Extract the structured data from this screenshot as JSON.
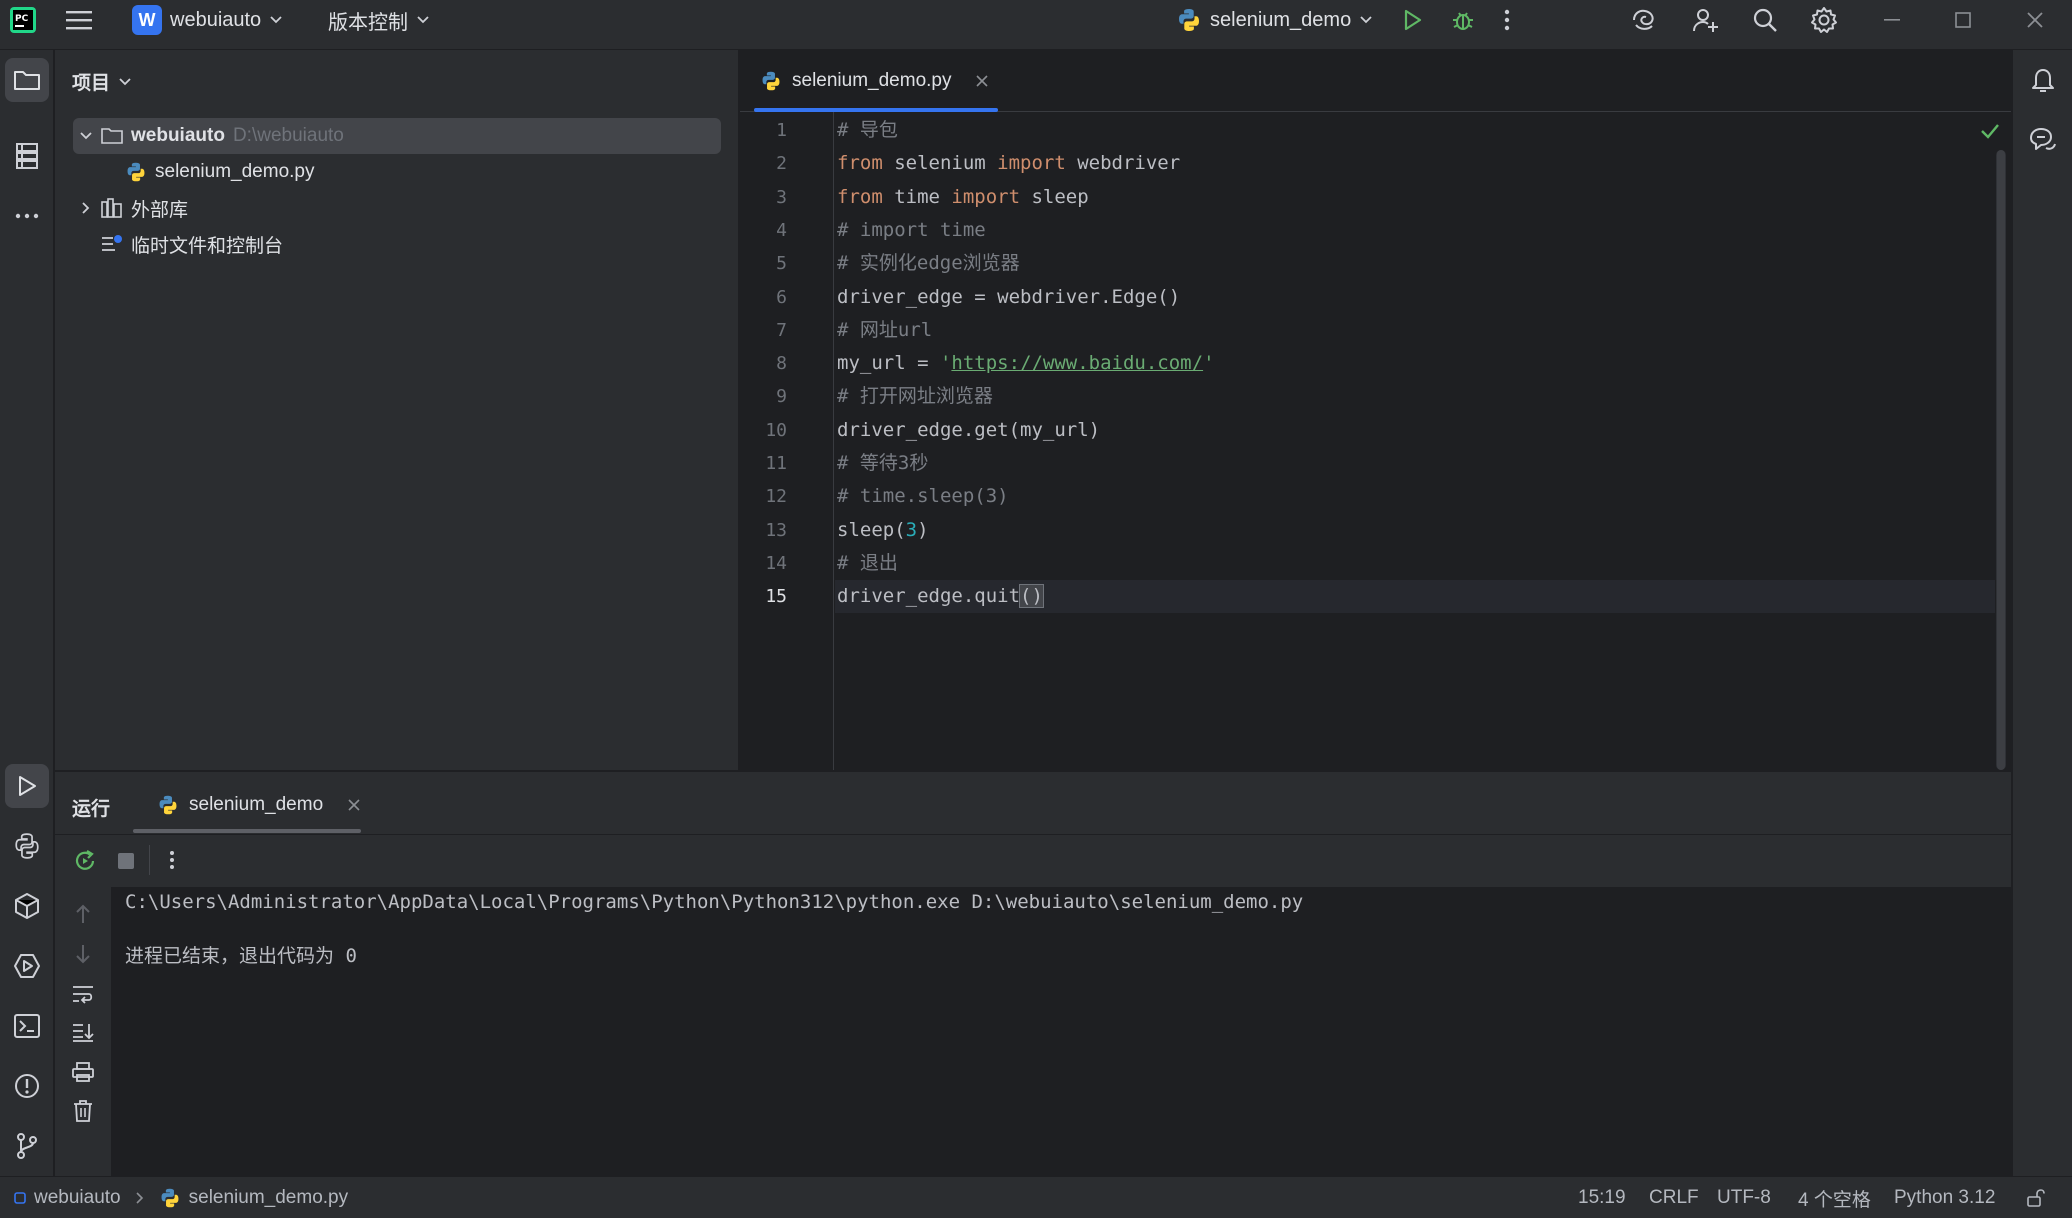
{
  "titlebar": {
    "project_badge": "W",
    "project_name": "webuiauto",
    "vcs_label": "版本控制",
    "run_config": "selenium_demo"
  },
  "project_panel": {
    "title": "项目",
    "root_name": "webuiauto",
    "root_path": "D:\\webuiauto",
    "file_name": "selenium_demo.py",
    "external_libs": "外部库",
    "scratches": "临时文件和控制台"
  },
  "editor": {
    "tab_label": "selenium_demo.py",
    "lines": [
      {
        "n": "1",
        "parts": [
          {
            "t": "# 导包",
            "c": "c-com"
          }
        ]
      },
      {
        "n": "2",
        "parts": [
          {
            "t": "from",
            "c": "c-kw"
          },
          {
            "t": " selenium ",
            "c": "c-def"
          },
          {
            "t": "import",
            "c": "c-kw"
          },
          {
            "t": " webdriver",
            "c": "c-def"
          }
        ]
      },
      {
        "n": "3",
        "parts": [
          {
            "t": "from",
            "c": "c-kw"
          },
          {
            "t": " time ",
            "c": "c-def"
          },
          {
            "t": "import",
            "c": "c-kw"
          },
          {
            "t": " sleep",
            "c": "c-def"
          }
        ]
      },
      {
        "n": "4",
        "parts": [
          {
            "t": "# import time",
            "c": "c-com"
          }
        ]
      },
      {
        "n": "5",
        "parts": [
          {
            "t": "# 实例化edge浏览器",
            "c": "c-com"
          }
        ]
      },
      {
        "n": "6",
        "parts": [
          {
            "t": "driver_edge = webdriver.Edge()",
            "c": "c-def"
          }
        ]
      },
      {
        "n": "7",
        "parts": [
          {
            "t": "# 网址url",
            "c": "c-com"
          }
        ]
      },
      {
        "n": "8",
        "parts": [
          {
            "t": "my_url = ",
            "c": "c-def"
          },
          {
            "t": "'",
            "c": "c-str"
          },
          {
            "t": "https://www.baidu.com/",
            "c": "c-str",
            "u": true
          },
          {
            "t": "'",
            "c": "c-str"
          }
        ]
      },
      {
        "n": "9",
        "parts": [
          {
            "t": "# 打开网址浏览器",
            "c": "c-com"
          }
        ]
      },
      {
        "n": "10",
        "parts": [
          {
            "t": "driver_edge.get(my_url)",
            "c": "c-def"
          }
        ]
      },
      {
        "n": "11",
        "parts": [
          {
            "t": "# 等待3秒",
            "c": "c-com"
          }
        ]
      },
      {
        "n": "12",
        "parts": [
          {
            "t": "# time.sleep(3)",
            "c": "c-com"
          }
        ]
      },
      {
        "n": "13",
        "parts": [
          {
            "t": "sleep(",
            "c": "c-def"
          },
          {
            "t": "3",
            "c": "c-num"
          },
          {
            "t": ")",
            "c": "c-def"
          }
        ]
      },
      {
        "n": "14",
        "parts": [
          {
            "t": "# 退出",
            "c": "c-com"
          }
        ]
      },
      {
        "n": "15",
        "parts": [
          {
            "t": "driver_edge.quit",
            "c": "c-def"
          },
          {
            "t": "()",
            "c": "c-def",
            "hl": true
          }
        ]
      }
    ]
  },
  "run_panel": {
    "title": "运行",
    "tab_label": "selenium_demo",
    "command": "C:\\Users\\Administrator\\AppData\\Local\\Programs\\Python\\Python312\\python.exe D:\\webuiauto\\selenium_demo.py",
    "exit_message": "进程已结束，退出代码为 0"
  },
  "statusbar": {
    "project": "webuiauto",
    "file": "selenium_demo.py",
    "position": "15:19",
    "line_sep": "CRLF",
    "encoding": "UTF-8",
    "indent": "4 个空格",
    "interpreter": "Python 3.12"
  },
  "colors": {
    "accent": "#3574f0",
    "run_green": "#5fb865",
    "check_green": "#5fb865"
  }
}
